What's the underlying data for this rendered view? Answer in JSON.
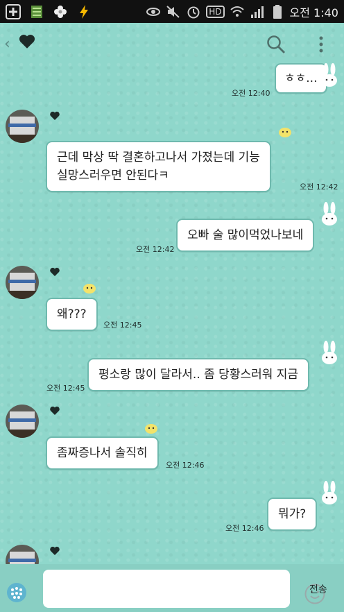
{
  "status_bar": {
    "time": "오전 1:40",
    "hd_label": "HD",
    "icons": [
      "plus-icon",
      "grid-app-icon",
      "flower-icon",
      "bolt-icon",
      "eye-icon",
      "mute-icon",
      "alarm-icon",
      "hd-icon",
      "wifi-icon",
      "signal-icon",
      "battery-icon"
    ]
  },
  "header": {
    "back_glyph": "‹",
    "title_icon": "heart-icon",
    "search_icon": "search-icon",
    "menu_icon": "more-vertical-icon"
  },
  "messages": [
    {
      "side": "right",
      "text": "ㅎㅎ...",
      "time": "오전 12:40"
    },
    {
      "side": "left",
      "text_line1": "근데 막상 딱 결혼하고나서 가졌는데 기능",
      "text_line2": "실망스러우면 안된다ㅋ",
      "time": "오전 12:42"
    },
    {
      "side": "right",
      "text": "오빠 술 많이먹었나보네",
      "time": "오전 12:42"
    },
    {
      "side": "left",
      "text": "왜???",
      "time": "오전 12:45"
    },
    {
      "side": "right",
      "text": "평소랑 많이 달라서.. 좀 당황스러워 지금",
      "time": "오전 12:45"
    },
    {
      "side": "left",
      "text": "좀짜증나서 솔직히",
      "time": "오전 12:46"
    },
    {
      "side": "right",
      "text": "뭐가?",
      "time": "오전 12:46"
    }
  ],
  "composer": {
    "input_value": "",
    "send_label": "전송",
    "emoji_icon": "smiley-icon",
    "attach_icon": "attach-dots-icon"
  },
  "colors": {
    "background": "#8fd7cb",
    "bubble_border": "#6fb9ae",
    "status_bar": "#111111"
  }
}
